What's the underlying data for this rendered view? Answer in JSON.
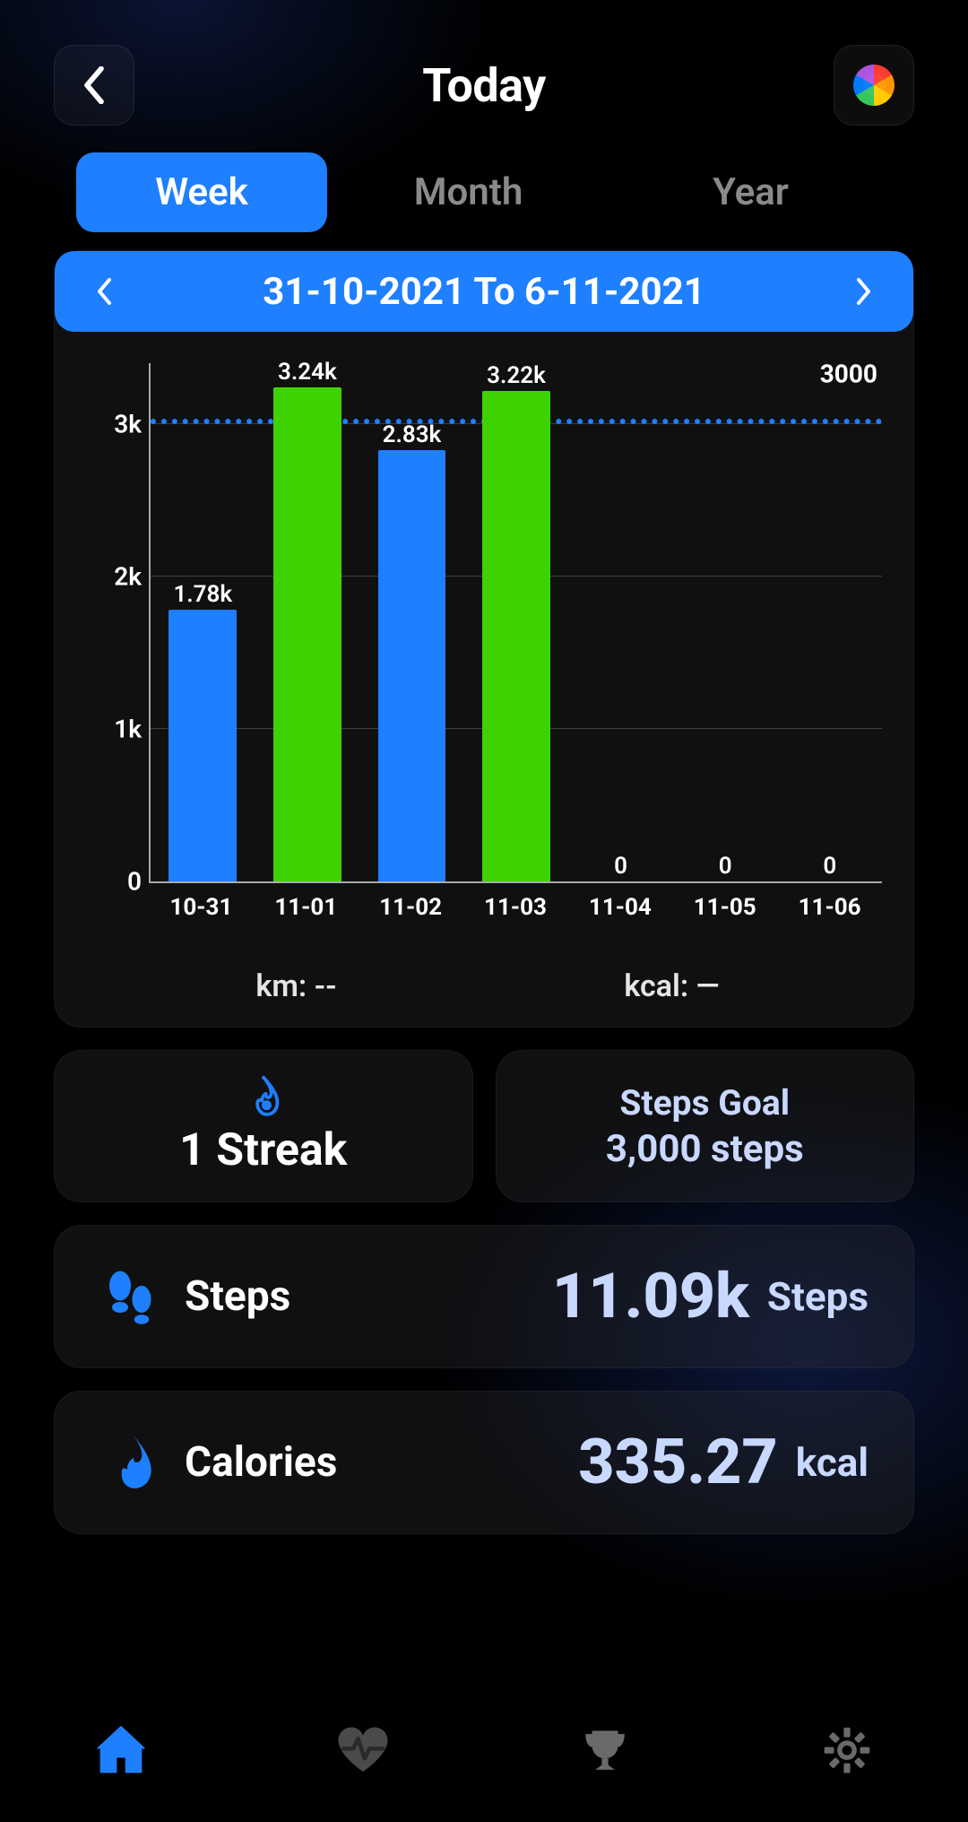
{
  "header": {
    "title": "Today"
  },
  "tabs": {
    "week": "Week",
    "month": "Month",
    "year": "Year",
    "active": "week"
  },
  "dateNav": {
    "range": "31-10-2021 To 6-11-2021"
  },
  "chart_data": {
    "type": "bar",
    "categories": [
      "10-31",
      "11-01",
      "11-02",
      "11-03",
      "11-04",
      "11-05",
      "11-06"
    ],
    "values": [
      1780,
      3240,
      2830,
      3220,
      0,
      0,
      0
    ],
    "value_labels": [
      "1.78k",
      "3.24k",
      "2.83k",
      "3.22k",
      "0",
      "0",
      "0"
    ],
    "goal": 3000,
    "goal_label": "3000",
    "yticks": [
      0,
      1000,
      2000,
      3000
    ],
    "ytick_labels": [
      "0",
      "1k",
      "2k",
      "3k"
    ],
    "ylim": [
      0,
      3400
    ],
    "colors": [
      "#1e7fff",
      "#3ed300",
      "#1e7fff",
      "#3ed300",
      "#1e7fff",
      "#1e7fff",
      "#1e7fff"
    ],
    "footer": {
      "km": "km: --",
      "kcal": "kcal: —"
    }
  },
  "streak": {
    "value": "1 Streak"
  },
  "goal": {
    "title": "Steps Goal",
    "value": "3,000 steps"
  },
  "metrics": {
    "steps": {
      "label": "Steps",
      "value": "11.09k",
      "unit": "Steps"
    },
    "calories": {
      "label": "Calories",
      "value": "335.27",
      "unit": "kcal"
    }
  }
}
